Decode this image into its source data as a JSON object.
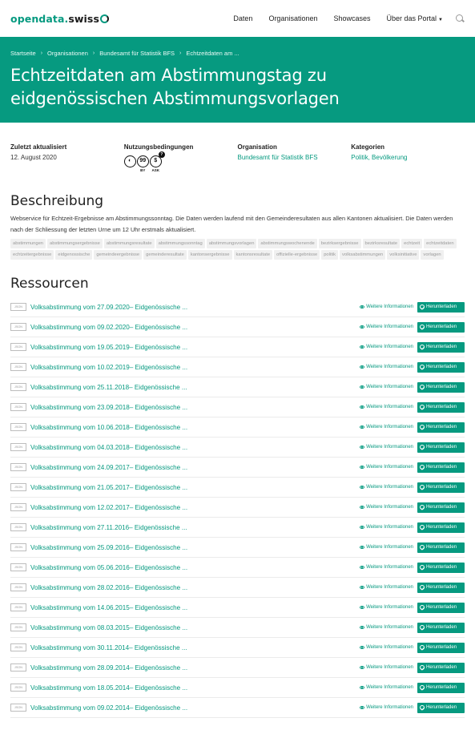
{
  "header": {
    "logo_a": "opendata.",
    "logo_b": "swiss",
    "nav": [
      "Daten",
      "Organisationen",
      "Showcases",
      "Über das Portal"
    ]
  },
  "breadcrumb": [
    "Startseite",
    "Organisationen",
    "Bundesamt für Statistik BFS",
    "Echtzeitdaten am ..."
  ],
  "title_line1": "Echtzeitdaten am Abstimmungstag zu",
  "title_line2": "eidgenössischen Abstimmungsvorlagen",
  "meta": {
    "updated_label": "Zuletzt aktualisiert",
    "updated_value": "12. August 2020",
    "terms_label": "Nutzungsbedingungen",
    "terms_icons": [
      "BY",
      "ASK"
    ],
    "org_label": "Organisation",
    "org_value": "Bundesamt für Statistik BFS",
    "cat_label": "Kategorien",
    "cat_value": "Politik, Bevölkerung"
  },
  "description": {
    "heading": "Beschreibung",
    "text": "Webservice für Echtzeit-Ergebnisse am Abstimmungssonntag. Die Daten werden laufend mit den Gemeinderesultaten aus allen Kantonen aktualisiert. Die Daten werden nach der Schliessung der letzten Urne um 12 Uhr erstmals aktualisiert.",
    "tags": [
      "abstimmungen",
      "abstimmungsergebnisse",
      "abstimmungsresultate",
      "abstimmungssonntag",
      "abstimmungsvorlagen",
      "abstimmungswochenende",
      "bezirksergebnisse",
      "bezirksresultate",
      "echtzeit",
      "echtzeitdaten",
      "echtzeitergebnisse",
      "eidgenossische",
      "gemeindeergebnisse",
      "gemeinderesultate",
      "kantonsergebnisse",
      "kantonsresultate",
      "offizielle-ergebnisse",
      "politik",
      "volksabstimmungen",
      "volksinitiative",
      "vorlagen"
    ]
  },
  "resources": {
    "heading": "Ressourcen",
    "format": "JSON",
    "info_label": "Weitere Informationen",
    "download_label": "Herunterladen",
    "items": [
      "Volksabstimmung vom 27.09.2020– Eidgenössische ...",
      "Volksabstimmung vom 09.02.2020– Eidgenössische ...",
      "Volksabstimmung vom 19.05.2019– Eidgenössische ...",
      "Volksabstimmung vom 10.02.2019– Eidgenössische ...",
      "Volksabstimmung vom 25.11.2018– Eidgenössische ...",
      "Volksabstimmung vom 23.09.2018– Eidgenössische ...",
      "Volksabstimmung vom 10.06.2018– Eidgenössische ...",
      "Volksabstimmung vom 04.03.2018– Eidgenössische ...",
      "Volksabstimmung vom 24.09.2017– Eidgenössische ...",
      "Volksabstimmung vom 21.05.2017– Eidgenössische ...",
      "Volksabstimmung vom 12.02.2017– Eidgenössische ...",
      "Volksabstimmung vom 27.11.2016– Eidgenössische ...",
      "Volksabstimmung vom 25.09.2016– Eidgenössische ...",
      "Volksabstimmung vom 05.06.2016– Eidgenössische ...",
      "Volksabstimmung vom 28.02.2016– Eidgenössische ...",
      "Volksabstimmung vom 14.06.2015– Eidgenössische ...",
      "Volksabstimmung vom 08.03.2015– Eidgenössische ...",
      "Volksabstimmung vom 30.11.2014– Eidgenössische ...",
      "Volksabstimmung vom 28.09.2014– Eidgenössische ...",
      "Volksabstimmung vom 18.05.2014– Eidgenössische ...",
      "Volksabstimmung vom 09.02.2014– Eidgenössische ..."
    ]
  }
}
